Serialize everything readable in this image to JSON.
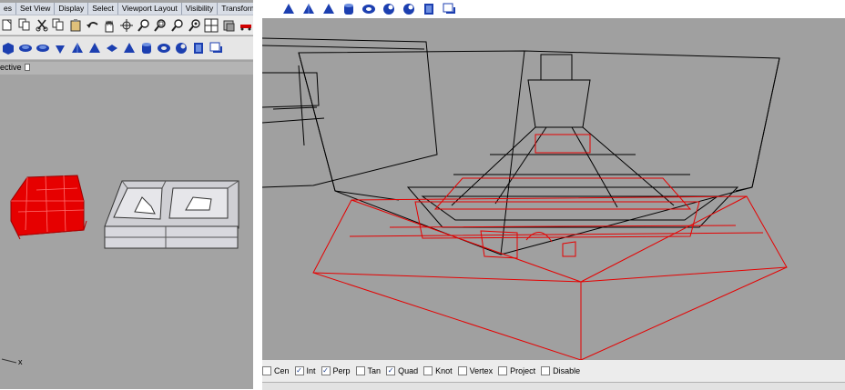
{
  "menubar": {
    "items": [
      "es",
      "Set View",
      "Display",
      "Select",
      "Viewport Layout",
      "Visibility",
      "Transform"
    ]
  },
  "left_toolbar_row1_icons": [
    "new-document-icon",
    "copy-icon",
    "cut-icon",
    "copy-icon",
    "paste-icon",
    "undo-icon",
    "pan-hand-icon",
    "rotate-view-icon",
    "zoom-icon",
    "zoom-window-icon",
    "zoom-extents-icon",
    "zoom-selected-icon",
    "four-viewports-icon",
    "layers-icon",
    "car-icon"
  ],
  "left_toolbar_row2_icons": [
    "box-icon",
    "ellipsoid-icon",
    "disc-icon",
    "cone-icon",
    "pyramid-icon",
    "truncated-pyramid-icon",
    "cylinder-icon",
    "torus-icon",
    "pipe-icon",
    "tube-icon",
    "extrude-icon",
    "shelf-icon",
    "plane-icon"
  ],
  "left_viewport": {
    "tab_label": "ective",
    "axis_label": "x"
  },
  "right_toolbar_icons": [
    "cone-icon",
    "pyramid-icon",
    "truncated-pyramid-icon",
    "cylinder-icon",
    "torus-icon",
    "pipe-icon",
    "tube-icon",
    "extrude-icon",
    "shelf-icon"
  ],
  "osnap": [
    {
      "label": "Cen",
      "checked": false
    },
    {
      "label": "Int",
      "checked": true
    },
    {
      "label": "Perp",
      "checked": true
    },
    {
      "label": "Tan",
      "checked": false
    },
    {
      "label": "Quad",
      "checked": true
    },
    {
      "label": "Knot",
      "checked": false
    },
    {
      "label": "Vertex",
      "checked": false
    },
    {
      "label": "Project",
      "checked": false
    },
    {
      "label": "Disable",
      "checked": false
    }
  ],
  "colors": {
    "selection_red": "#e60000",
    "wire_black": "#000000",
    "viewport_gray": "#a0a0a0",
    "icon_blue": "#1c3fb0"
  }
}
